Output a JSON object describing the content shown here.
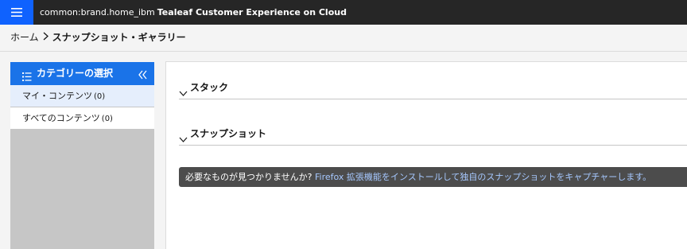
{
  "header": {
    "title_prefix": "common:brand.home_ibm",
    "title_product": "Tealeaf Customer Experience on Cloud"
  },
  "breadcrumb": {
    "home": "ホーム",
    "current": "スナップショット・ギャラリー"
  },
  "sidebar": {
    "title": "カテゴリーの選択",
    "items": [
      {
        "label": "マイ・コンテンツ",
        "count": "(0)"
      },
      {
        "label": "すべてのコンテンツ",
        "count": "(0)"
      }
    ]
  },
  "main": {
    "sections": [
      {
        "label": "スタック"
      },
      {
        "label": "スナップショット"
      }
    ],
    "notice": {
      "question": "必要なものが見つかりませんか?",
      "link": "Firefox 拡張機能をインストールして独自のスナップショットをキャプチャーします。"
    }
  },
  "colors": {
    "topbar": "#262626",
    "accent": "#0f62fe",
    "sidebar_header": "#1a73e8",
    "notice_bg": "#4c4c4c",
    "notice_link": "#a6c8ff"
  }
}
